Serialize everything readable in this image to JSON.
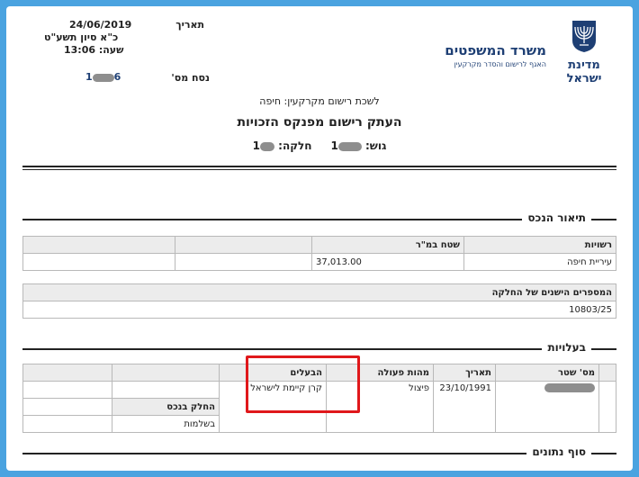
{
  "header": {
    "date_label": "תאריך",
    "date_value": "24/06/2019",
    "hebrew_date": "כ\"א סיון תשע\"ט",
    "time_text": "שעה: 13:06",
    "version_label": "נסח מס'",
    "version_value_prefix": "1",
    "version_value_suffix": "6"
  },
  "ministry": {
    "name": "משרד המשפטים",
    "subtitle": "האגף לרישום והסדר מקרקעין",
    "state": "מדינת ישראל"
  },
  "registry_office": "לשכת רישום מקרקעין: חיפה",
  "document_title": "העתק רישום מפנקס הזכויות",
  "parcel": {
    "gush_label": "גוש:",
    "gush_value": "1",
    "helka_label": "חלקה:",
    "helka_value": "1"
  },
  "property": {
    "section_title": "תיאור הנכס",
    "col_authority": "רשויות",
    "col_area": "שטח במ\"ר",
    "authority": "עיריית חיפה",
    "area": "37,013.00",
    "old_numbers_label": "המספרים הישנים של החלקה",
    "old_number": "10803/25"
  },
  "ownership": {
    "section_title": "בעלויות",
    "col_deed": "מס' שטר",
    "col_date": "תאריך",
    "col_action": "מהות פעולה",
    "col_owners": "הבעלים",
    "date": "23/10/1991",
    "action": "פיצול",
    "owner": "קרן קיימת לישראל",
    "share_label": "החלק בנכס",
    "share_value": "בשלמות"
  },
  "footer": {
    "end_title": "סוף נתונים"
  },
  "colors": {
    "highlight": "#e0181b",
    "brand": "#1e3f74"
  }
}
